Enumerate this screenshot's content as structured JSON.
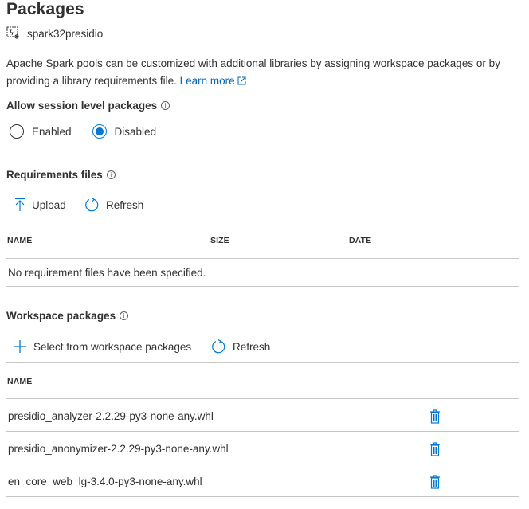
{
  "header": {
    "title": "Packages",
    "resource_icon": "spark-pool-icon",
    "resource_name": "spark32presidio"
  },
  "description": {
    "text": "Apache Spark pools can be customized with additional libraries by assigning workspace packages or by providing a library requirements file.",
    "link_label": "Learn more",
    "link_icon": "external-link-icon"
  },
  "session_packages": {
    "label": "Allow session level packages",
    "info_icon": "info-icon",
    "options": [
      {
        "label": "Enabled",
        "selected": false
      },
      {
        "label": "Disabled",
        "selected": true
      }
    ]
  },
  "requirements": {
    "label": "Requirements files",
    "info_icon": "info-icon",
    "toolbar": {
      "upload_label": "Upload",
      "refresh_label": "Refresh"
    },
    "columns": [
      "NAME",
      "SIZE",
      "DATE"
    ],
    "empty_message": "No requirement files have been specified."
  },
  "workspace_packages": {
    "label": "Workspace packages",
    "info_icon": "info-icon",
    "toolbar": {
      "select_label": "Select from workspace packages",
      "refresh_label": "Refresh"
    },
    "columns": [
      "NAME"
    ],
    "rows": [
      {
        "name": "presidio_analyzer-2.2.29-py3-none-any.whl",
        "action_icon": "trash-icon"
      },
      {
        "name": "presidio_anonymizer-2.2.29-py3-none-any.whl",
        "action_icon": "trash-icon"
      },
      {
        "name": "en_core_web_lg-3.4.0-py3-none-any.whl",
        "action_icon": "trash-icon"
      }
    ]
  },
  "colors": {
    "accent": "#0078d4",
    "link": "#0067b8",
    "text": "#323130",
    "divider": "#c8c6c4"
  }
}
